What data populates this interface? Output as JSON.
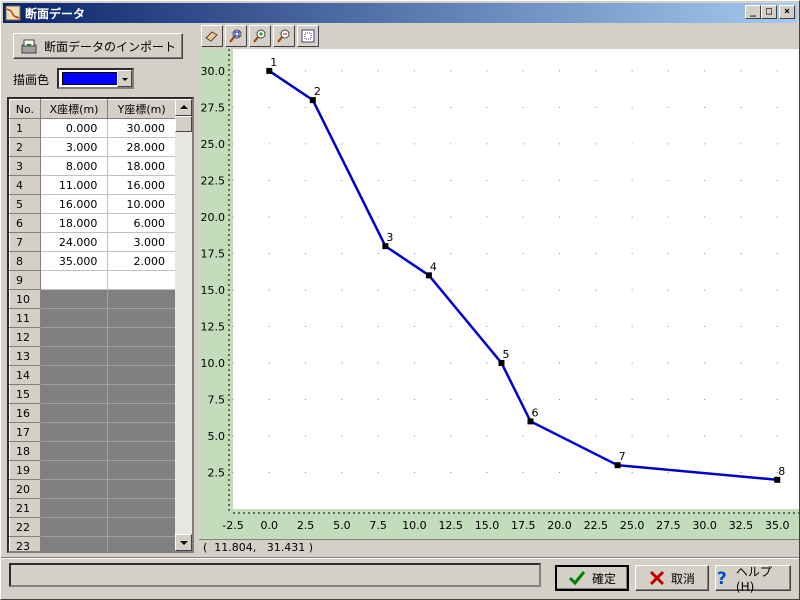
{
  "window": {
    "title": "断面データ",
    "minimize": "_",
    "maximize": "□",
    "close": "×"
  },
  "import_button": {
    "label": "断面データのインポート"
  },
  "draw_color": {
    "label": "描画色",
    "value": "#0000ff"
  },
  "grid": {
    "headers": [
      "No.",
      "X座標(m)",
      "Y座標(m)"
    ],
    "rows": [
      {
        "no": "1",
        "x": "0.000",
        "y": "30.000"
      },
      {
        "no": "2",
        "x": "3.000",
        "y": "28.000"
      },
      {
        "no": "3",
        "x": "8.000",
        "y": "18.000"
      },
      {
        "no": "4",
        "x": "11.000",
        "y": "16.000"
      },
      {
        "no": "5",
        "x": "16.000",
        "y": "10.000"
      },
      {
        "no": "6",
        "x": "18.000",
        "y": "6.000"
      },
      {
        "no": "7",
        "x": "24.000",
        "y": "3.000"
      },
      {
        "no": "8",
        "x": "35.000",
        "y": "2.000"
      },
      {
        "no": "9",
        "x": "",
        "y": ""
      },
      {
        "no": "10",
        "x": "",
        "y": ""
      },
      {
        "no": "11",
        "x": "",
        "y": ""
      },
      {
        "no": "12",
        "x": "",
        "y": ""
      },
      {
        "no": "13",
        "x": "",
        "y": ""
      },
      {
        "no": "14",
        "x": "",
        "y": ""
      },
      {
        "no": "15",
        "x": "",
        "y": ""
      },
      {
        "no": "16",
        "x": "",
        "y": ""
      },
      {
        "no": "17",
        "x": "",
        "y": ""
      },
      {
        "no": "18",
        "x": "",
        "y": ""
      },
      {
        "no": "19",
        "x": "",
        "y": ""
      },
      {
        "no": "20",
        "x": "",
        "y": ""
      },
      {
        "no": "21",
        "x": "",
        "y": ""
      },
      {
        "no": "22",
        "x": "",
        "y": ""
      },
      {
        "no": "23",
        "x": "",
        "y": ""
      }
    ]
  },
  "toolbar": {
    "tools": [
      "eraser-icon",
      "zoom-region-icon",
      "zoom-in-icon",
      "zoom-out-icon",
      "fit-view-icon"
    ]
  },
  "coords": {
    "text": "(  11.804,   31.431 )"
  },
  "buttons": {
    "ok": "確定",
    "cancel": "取消",
    "help": "ヘルプ(H)"
  },
  "chart_data": {
    "type": "line",
    "series": [
      {
        "color": "#0000cc",
        "x": [
          0,
          3,
          8,
          11,
          16,
          18,
          24,
          35
        ],
        "y": [
          30,
          28,
          18,
          16,
          10,
          6,
          3,
          2
        ],
        "labels": [
          "1",
          "2",
          "3",
          "4",
          "5",
          "6",
          "7",
          "8"
        ]
      }
    ],
    "xticks": [
      "-2.5",
      "0.0",
      "2.5",
      "5.0",
      "7.5",
      "10.0",
      "12.5",
      "15.0",
      "17.5",
      "20.0",
      "22.5",
      "25.0",
      "27.5",
      "30.0",
      "32.5",
      "35.0"
    ],
    "yticks": [
      "2.5",
      "5.0",
      "7.5",
      "10.0",
      "12.5",
      "15.0",
      "17.5",
      "20.0",
      "22.5",
      "25.0",
      "27.5",
      "30.0"
    ],
    "xlim": [
      -2.5,
      36.5
    ],
    "ylim": [
      0,
      31.5
    ],
    "grid": true
  }
}
